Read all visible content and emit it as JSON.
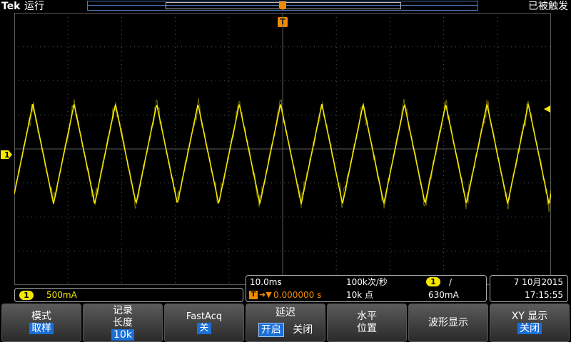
{
  "header": {
    "brand": "Tek",
    "run_state": "运行",
    "trigger_state": "已被触发"
  },
  "trigger_marker": {
    "label": "T"
  },
  "channel1": {
    "badge": "1",
    "scale": "500mA",
    "color": "#f5e800"
  },
  "horizontal": {
    "timebase": "10.0ms",
    "delay": "0.000000 s",
    "sample_rate": "100k次/秒",
    "record_points": "10k 点",
    "trigger_source_badge": "1",
    "trigger_slope": "/",
    "trigger_level": "630mA"
  },
  "datetime": {
    "date": "7 10月2015",
    "time": "17:15:55"
  },
  "menu": {
    "mode": {
      "label": "模式",
      "value": "取样"
    },
    "record_length": {
      "label1": "记录",
      "label2": "长度",
      "value": "10k"
    },
    "fastacq": {
      "label": "FastAcq",
      "value": "关"
    },
    "delay": {
      "label": "延迟",
      "on": "开启",
      "off": "关闭"
    },
    "horizontal_position": {
      "label1": "水平",
      "label2": "位置"
    },
    "waveform_display": {
      "label": "波形显示"
    },
    "xy_display": {
      "label": "XY 显示",
      "value": "关闭"
    }
  },
  "colors": {
    "trace": "#f5e800",
    "trigger": "#f08a00",
    "accent": "#1b6fd6",
    "grid": "#5a5a5a"
  }
}
